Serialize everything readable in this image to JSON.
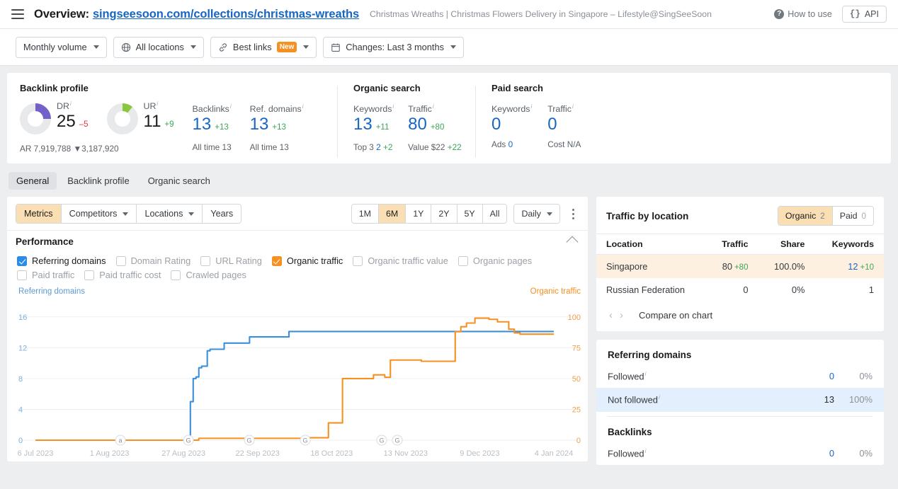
{
  "header": {
    "menu_icon": "hamburger-icon",
    "overview_label": "Overview:",
    "url": "singseesoon.com/collections/christmas-wreaths",
    "page_description": "Christmas Wreaths | Christmas Flowers Delivery in Singapore – Lifestyle@SingSeeSoon",
    "how_to_use": "How to use",
    "api_label": "API",
    "api_icon": "code-braces-icon"
  },
  "filters": [
    {
      "label": "Monthly volume",
      "icon": null,
      "badge": null,
      "caret": true
    },
    {
      "label": "All locations",
      "icon": "globe-icon",
      "badge": null,
      "caret": true
    },
    {
      "label": "Best links",
      "icon": "link-icon",
      "badge": "New",
      "caret": true
    },
    {
      "label": "Changes: Last 3 months",
      "icon": "calendar-icon",
      "badge": null,
      "caret": true
    }
  ],
  "metrics": {
    "backlink_profile": {
      "title": "Backlink profile",
      "dr": {
        "label": "DR",
        "value": "25",
        "delta": "–5",
        "delta_sign": "neg",
        "ring_pct": 25,
        "ring_color": "#7461c8"
      },
      "ur": {
        "label": "UR",
        "value": "11",
        "delta": "+9",
        "delta_sign": "pos",
        "ring_pct": 11,
        "ring_color": "#8cc63e"
      },
      "backlinks": {
        "label": "Backlinks",
        "value": "13",
        "delta": "+13",
        "delta_sign": "pos",
        "sub_label": "All time",
        "sub_value": "13"
      },
      "ref_domains": {
        "label": "Ref. domains",
        "value": "13",
        "delta": "+13",
        "delta_sign": "pos",
        "sub_label": "All time",
        "sub_value": "13"
      },
      "ar": {
        "label": "AR",
        "value": "7,919,788",
        "delta": "3,187,920",
        "delta_sign": "neg"
      }
    },
    "organic_search": {
      "title": "Organic search",
      "keywords": {
        "label": "Keywords",
        "value": "13",
        "delta": "+11",
        "sub_label": "Top 3",
        "sub_value": "2",
        "sub_delta": "+2"
      },
      "traffic": {
        "label": "Traffic",
        "value": "80",
        "delta": "+80",
        "sub_label": "Value",
        "sub_value": "$22",
        "sub_delta": "+22"
      }
    },
    "paid_search": {
      "title": "Paid search",
      "keywords": {
        "label": "Keywords",
        "value": "0",
        "sub_label": "Ads",
        "sub_value": "0"
      },
      "traffic": {
        "label": "Traffic",
        "value": "0",
        "sub_label": "Cost",
        "sub_value": "N/A"
      }
    }
  },
  "section_tabs": [
    {
      "label": "General",
      "active": true
    },
    {
      "label": "Backlink profile",
      "active": false
    },
    {
      "label": "Organic search",
      "active": false
    }
  ],
  "chart_toolbar": {
    "left_segments": [
      {
        "label": "Metrics",
        "selected": true,
        "caret": false
      },
      {
        "label": "Competitors",
        "selected": false,
        "caret": true
      },
      {
        "label": "Locations",
        "selected": false,
        "caret": true
      },
      {
        "label": "Years",
        "selected": false,
        "caret": false
      }
    ],
    "ranges": [
      {
        "label": "1M",
        "selected": false
      },
      {
        "label": "6M",
        "selected": true
      },
      {
        "label": "1Y",
        "selected": false
      },
      {
        "label": "2Y",
        "selected": false
      },
      {
        "label": "5Y",
        "selected": false
      },
      {
        "label": "All",
        "selected": false
      }
    ],
    "granularity": {
      "label": "Daily",
      "caret": true
    },
    "more_icon": "more-vertical-icon"
  },
  "performance": {
    "title": "Performance",
    "collapse_icon": "chevron-up-icon",
    "checkboxes": [
      {
        "label": "Referring domains",
        "checked": true,
        "color": "blue"
      },
      {
        "label": "Domain Rating",
        "checked": false,
        "color": null
      },
      {
        "label": "URL Rating",
        "checked": false,
        "color": null
      },
      {
        "label": "Organic traffic",
        "checked": true,
        "color": "orange"
      },
      {
        "label": "Organic traffic value",
        "checked": false,
        "color": null
      },
      {
        "label": "Organic pages",
        "checked": false,
        "color": null
      },
      {
        "label": "Paid traffic",
        "checked": false,
        "color": null
      },
      {
        "label": "Paid traffic cost",
        "checked": false,
        "color": null
      },
      {
        "label": "Crawled pages",
        "checked": false,
        "color": null
      }
    ]
  },
  "chart_data": {
    "type": "line",
    "title": "",
    "left_axis_label": "Referring domains",
    "right_axis_label": "Organic traffic",
    "left_axis_color": "#5b9bd5",
    "right_axis_color": "#f59021",
    "xlabel": "",
    "grid": true,
    "legend_position": "axis-titles",
    "x_tick_labels": [
      "6 Jul 2023",
      "1 Aug 2023",
      "27 Aug 2023",
      "22 Sep 2023",
      "18 Oct 2023",
      "13 Nov 2023",
      "9 Dec 2023",
      "4 Jan 2024"
    ],
    "left_ticks": [
      0,
      4,
      8,
      12,
      16
    ],
    "right_ticks": [
      0,
      25,
      50,
      75,
      100
    ],
    "ylim_left": [
      0,
      18
    ],
    "ylim_right": [
      0,
      112.5
    ],
    "annotations": [
      {
        "label": "a",
        "x_date": "1 Aug 2023"
      },
      {
        "label": "G",
        "x_date": "27 Aug 2023"
      },
      {
        "label": "G",
        "x_date": "22 Sep 2023"
      },
      {
        "label": "G",
        "x_date": "9 Oct 2023"
      },
      {
        "label": "G",
        "x_date": "13 Nov 2023"
      },
      {
        "label": "G",
        "x_date": "17 Nov 2023"
      }
    ],
    "series": [
      {
        "name": "Referring domains",
        "color": "#3d8fd8",
        "axis": "left",
        "points": [
          [
            0,
            0
          ],
          [
            54,
            0
          ],
          [
            55,
            5
          ],
          [
            56,
            8
          ],
          [
            57,
            8.2
          ],
          [
            58,
            9.4
          ],
          [
            59,
            9.6
          ],
          [
            61,
            11.6
          ],
          [
            62,
            11.8
          ],
          [
            66,
            11.8
          ],
          [
            67,
            12.6
          ],
          [
            74,
            12.6
          ],
          [
            76,
            13.4
          ],
          [
            89,
            13.4
          ],
          [
            90,
            14.1
          ],
          [
            184,
            14.1
          ]
        ]
      },
      {
        "name": "Organic traffic",
        "color": "#f59021",
        "axis": "right",
        "points": [
          [
            0,
            0
          ],
          [
            56,
            0
          ],
          [
            58,
            1.5
          ],
          [
            95,
            1.5
          ],
          [
            97,
            2
          ],
          [
            103,
            2
          ],
          [
            104,
            14
          ],
          [
            108,
            14
          ],
          [
            109,
            50
          ],
          [
            118,
            50
          ],
          [
            120,
            53
          ],
          [
            123,
            53
          ],
          [
            124,
            51
          ],
          [
            126,
            65
          ],
          [
            136,
            65
          ],
          [
            137,
            64
          ],
          [
            148,
            64
          ],
          [
            149,
            88
          ],
          [
            151,
            92
          ],
          [
            153,
            95
          ],
          [
            156,
            99
          ],
          [
            159,
            99
          ],
          [
            161,
            98
          ],
          [
            164,
            96
          ],
          [
            166,
            96
          ],
          [
            168,
            90
          ],
          [
            170,
            87
          ],
          [
            172,
            86
          ],
          [
            184,
            86
          ]
        ]
      }
    ]
  },
  "traffic_by_location": {
    "title": "Traffic by location",
    "tabs": [
      {
        "label": "Organic",
        "count": "2",
        "selected": true
      },
      {
        "label": "Paid",
        "count": "0",
        "selected": false
      }
    ],
    "columns": [
      "Location",
      "Traffic",
      "Share",
      "Keywords"
    ],
    "rows": [
      {
        "location": "Singapore",
        "traffic": "80",
        "traffic_delta": "+80",
        "share": "100.0%",
        "keywords": "12",
        "keywords_delta": "+10",
        "highlighted": true
      },
      {
        "location": "Russian Federation",
        "traffic": "0",
        "traffic_delta": "",
        "share": "0%",
        "keywords": "1",
        "keywords_delta": "",
        "highlighted": false
      }
    ],
    "prev_icon": "chevron-left-icon",
    "next_icon": "chevron-right-icon",
    "compare_label": "Compare on chart"
  },
  "referring_domains_panel": {
    "title": "Referring domains",
    "rows": [
      {
        "label": "Followed",
        "value": "0",
        "percent": "0%",
        "highlighted": false
      },
      {
        "label": "Not followed",
        "value": "13",
        "percent": "100%",
        "highlighted": true
      }
    ]
  },
  "backlinks_panel": {
    "title": "Backlinks",
    "rows": [
      {
        "label": "Followed",
        "value": "0",
        "percent": "0%",
        "highlighted": false
      }
    ]
  }
}
